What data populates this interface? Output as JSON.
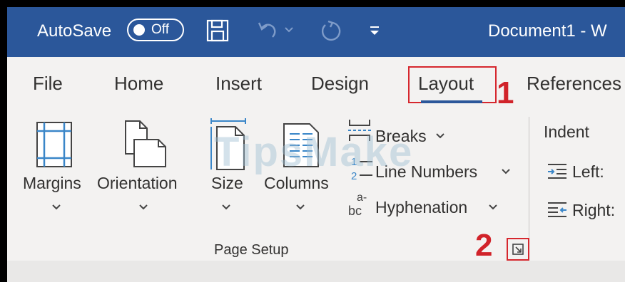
{
  "titlebar": {
    "autosave_label": "AutoSave",
    "toggle_state": "Off",
    "document_title": "Document1  -  W",
    "bg_color": "#2b579a"
  },
  "tabs": [
    {
      "label": "File"
    },
    {
      "label": "Home"
    },
    {
      "label": "Insert"
    },
    {
      "label": "Design"
    },
    {
      "label": "Layout",
      "active": true
    },
    {
      "label": "References"
    }
  ],
  "annotations": {
    "step1": "1",
    "step2": "2",
    "color": "#d1232a"
  },
  "ribbon": {
    "margins_label": "Margins",
    "orientation_label": "Orientation",
    "size_label": "Size",
    "columns_label": "Columns",
    "breaks_label": "Breaks",
    "line_numbers_label": "Line Numbers",
    "hyphenation_label": "Hyphenation",
    "page_setup_group": "Page Setup",
    "indent_label": "Indent",
    "left_label": "Left:",
    "right_label": "Right:"
  },
  "watermark": "TipsMake"
}
